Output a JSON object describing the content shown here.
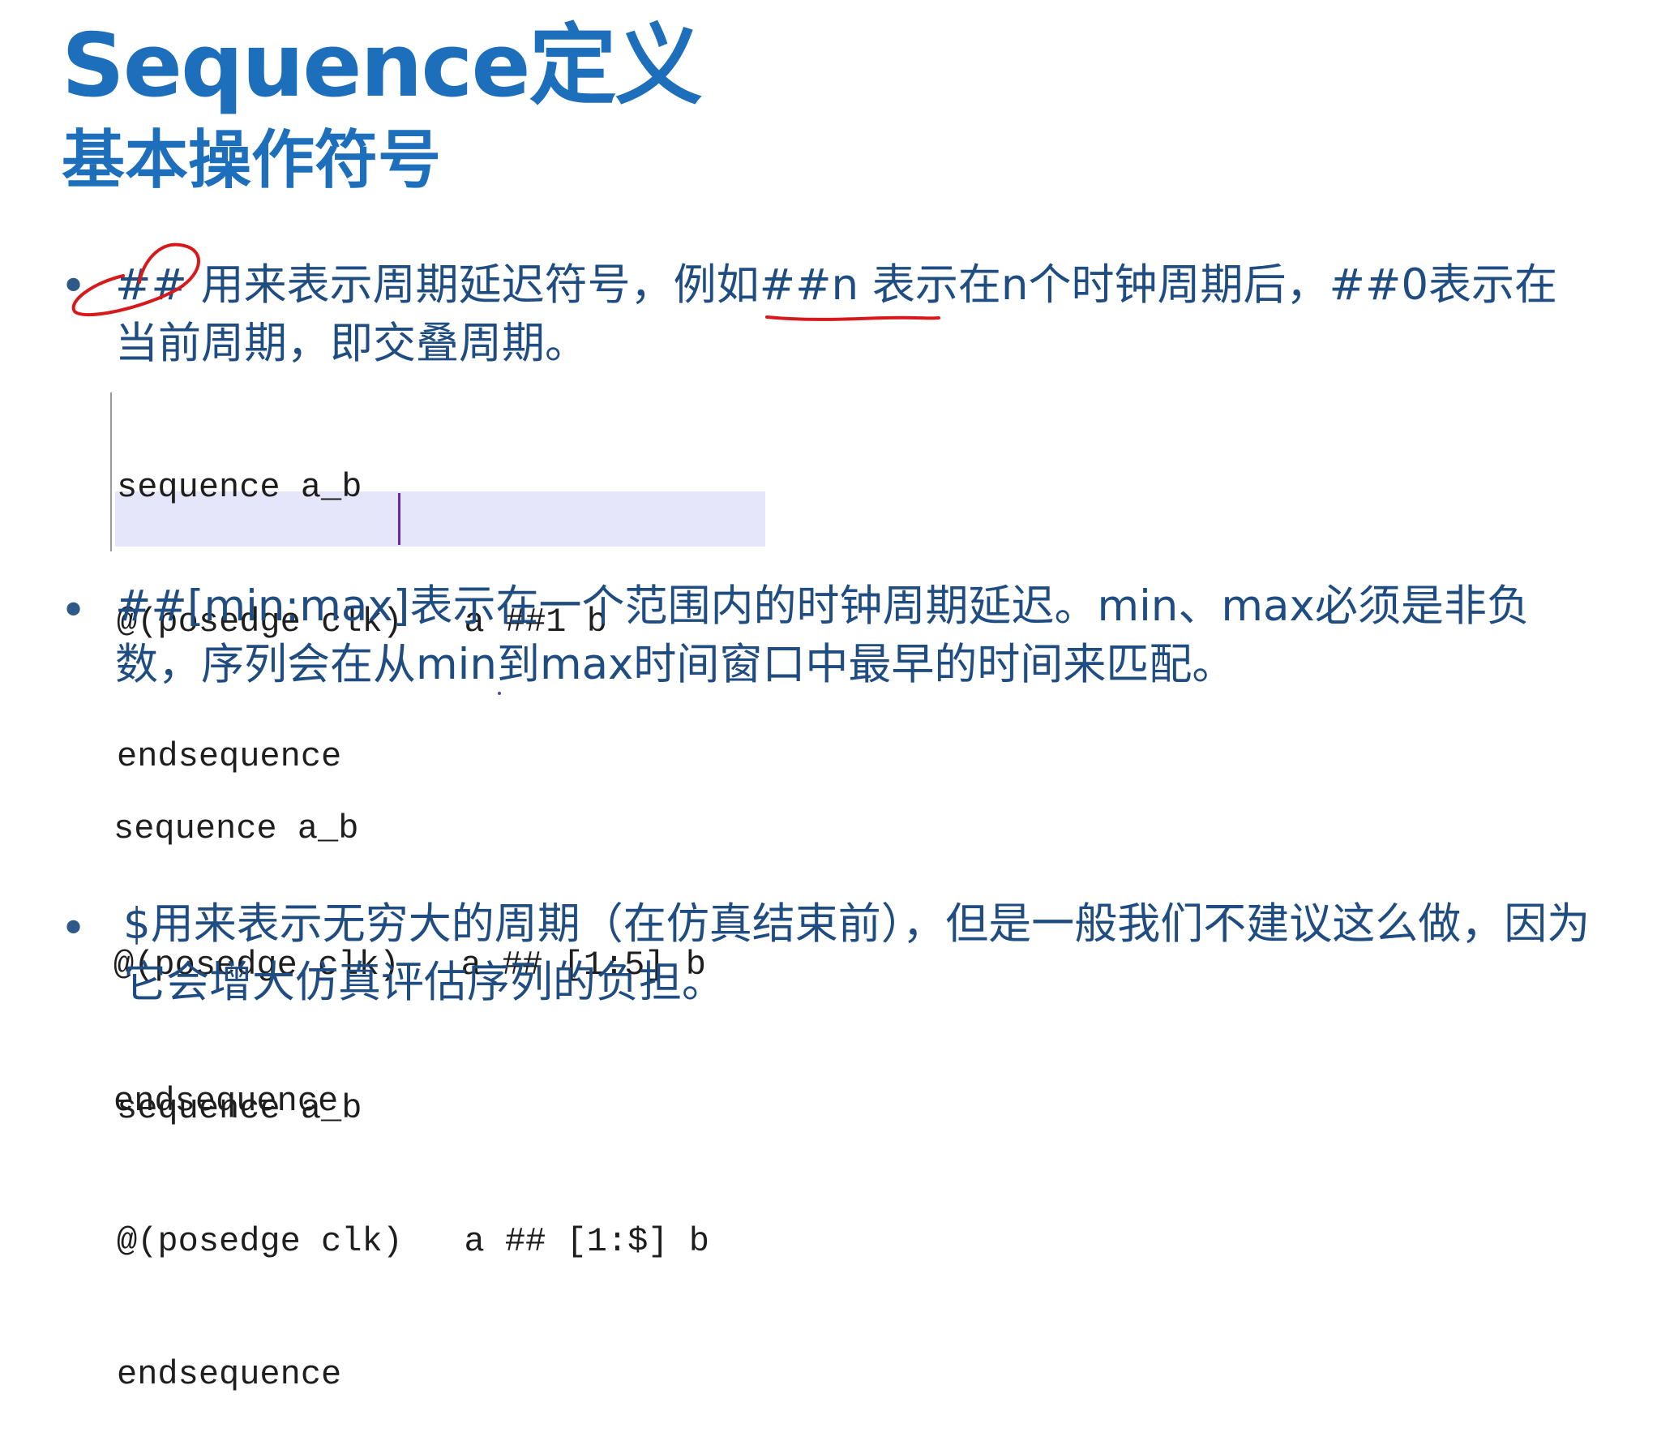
{
  "slide": {
    "title": "Sequence定义",
    "subtitle": "基本操作符号"
  },
  "bullets": [
    {
      "marker": "•",
      "text": "## 用来表示周期延迟符号，例如##n 表示在n个时钟周期后，##0表示在当前周期，即交叠周期。",
      "code": [
        "sequence a_b",
        "@(posedge clk)   a ##1 b",
        "endsequence"
      ]
    },
    {
      "marker": "•",
      "text": "##[min:max]表示在一个范围内的时钟周期延迟。min、max必须是非负数，序列会在从min到max时间窗口中最早的时间来匹配。",
      "code": [
        "sequence a_b",
        "@(posedge clk)   a ## [1:5] b",
        "endsequence"
      ]
    },
    {
      "marker": "•",
      "text": "$用来表示无穷大的周期（在仿真结束前），但是一般我们不建议这么做，因为它会增大仿真评估序列的负担。",
      "code": [
        "sequence a_b",
        "@(posedge clk)   a ## [1:$] b",
        "endsequence"
      ]
    }
  ],
  "colors": {
    "heading": "#1d6fbb",
    "body_text": "#1f4d82",
    "annotation": "#d7191c",
    "editor_highlight": "#e6e6fb"
  }
}
